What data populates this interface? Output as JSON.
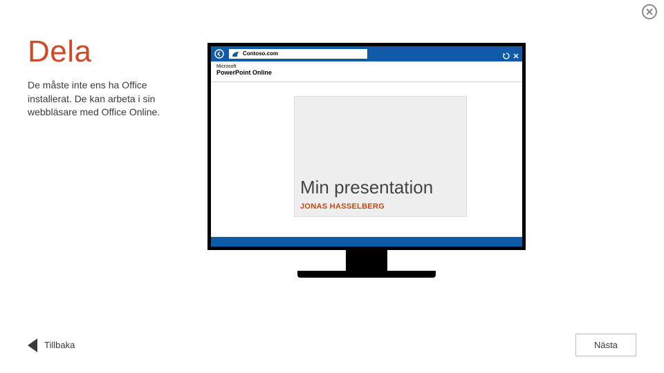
{
  "title": "Dela",
  "body": "De måste inte ens ha Office installerat. De kan arbeta i sin webbläsare med Office Online.",
  "browser": {
    "address": "Contoso.com",
    "app_brand": "Microsoft",
    "app_product": "PowerPoint Online"
  },
  "slide": {
    "title": "Min presentation",
    "subtitle": "JONAS HASSELBERG"
  },
  "nav": {
    "back": "Tillbaka",
    "next": "Nästa"
  },
  "icons": {
    "close": "close-icon",
    "back_arrow": "arrow-left-icon",
    "browser_back": "back-circle-icon",
    "page_icon": "page-curl-icon",
    "refresh": "refresh-icon",
    "window_close": "window-close-icon"
  },
  "colors": {
    "accent": "#D24726",
    "blue": "#0F5BA7"
  }
}
